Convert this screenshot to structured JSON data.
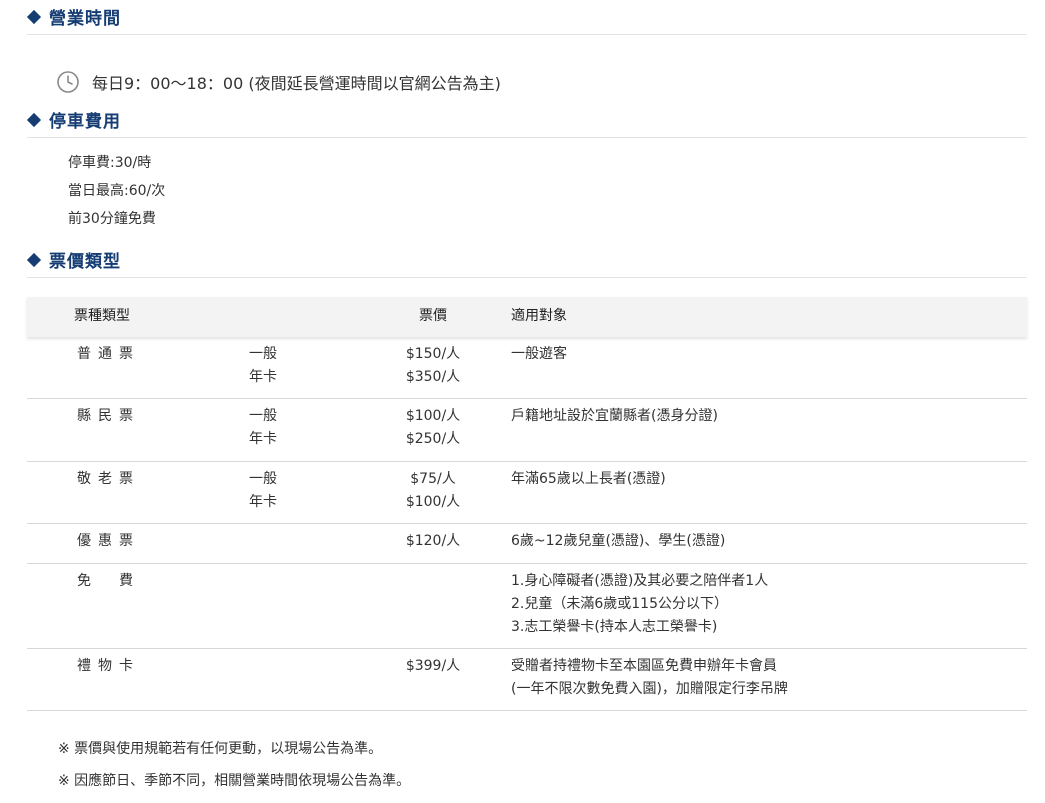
{
  "sections": {
    "hours": {
      "title": "營業時間",
      "text": "每日9：00～18：00 (夜間延長營運時間以官網公告為主)"
    },
    "parking": {
      "title": "停車費用",
      "items": [
        "停車費:30/時",
        "當日最高:60/次",
        "前30分鐘免費"
      ]
    },
    "tickets": {
      "title": "票價類型",
      "headers": {
        "type": "票種類型",
        "price": "票價",
        "target": "適用對象"
      },
      "rows": [
        {
          "type": "普通票",
          "sub1": "一般",
          "sub2": "年卡",
          "price1": "$150/人",
          "price2": "$350/人",
          "target1": "一般遊客",
          "target2": "",
          "target3": ""
        },
        {
          "type": "縣民票",
          "sub1": "一般",
          "sub2": "年卡",
          "price1": "$100/人",
          "price2": "$250/人",
          "target1": "戶籍地址設於宜蘭縣者(憑身分證)",
          "target2": "",
          "target3": ""
        },
        {
          "type": "敬老票",
          "sub1": "一般",
          "sub2": "年卡",
          "price1": "$75/人",
          "price2": "$100/人",
          "target1": "年滿65歲以上長者(憑證)",
          "target2": "",
          "target3": ""
        },
        {
          "type": "優惠票",
          "sub1": "",
          "sub2": "",
          "price1": "$120/人",
          "price2": "",
          "target1": "6歲~12歲兒童(憑證)、學生(憑證)",
          "target2": "",
          "target3": ""
        },
        {
          "type": "免　費",
          "sub1": "",
          "sub2": "",
          "price1": "",
          "price2": "",
          "target1": "1.身心障礙者(憑證)及其必要之陪伴者1人",
          "target2": "2.兒童（未滿6歲或115公分以下）",
          "target3": "3.志工榮譽卡(持本人志工榮譽卡)"
        },
        {
          "type": "禮物卡",
          "sub1": "",
          "sub2": "",
          "price1": "$399/人",
          "price2": "",
          "target1": "受贈者持禮物卡至本園區免費申辦年卡會員",
          "target2": "(一年不限次數免費入園)，加贈限定行李吊牌",
          "target3": ""
        }
      ]
    }
  },
  "notes": [
    "※ 票價與使用規範若有任何更動，以現場公告為準。",
    "※ 因應節日、季節不同，相關營業時間依現場公告為準。"
  ],
  "icons": {
    "hours": "clock-icon",
    "section": "diamond-bullet-icon"
  },
  "colors": {
    "accent": "#153d73",
    "header_bg": "#f3f3f3",
    "divider": "#d8d8d8"
  }
}
